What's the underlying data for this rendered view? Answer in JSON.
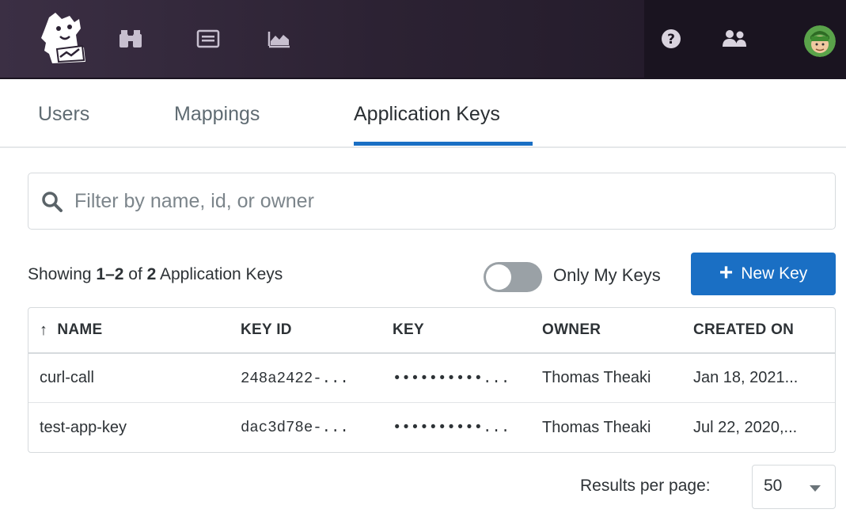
{
  "nav": {
    "icons": [
      "dog-logo-icon",
      "binoculars-icon",
      "monitor-icon",
      "metrics-chart-icon",
      "help-icon",
      "team-icon",
      "avatar"
    ]
  },
  "tabs": [
    {
      "label": "Users",
      "active": false
    },
    {
      "label": "Mappings",
      "active": false
    },
    {
      "label": "Application Keys",
      "active": true
    }
  ],
  "search": {
    "placeholder": "Filter by name, id, or owner",
    "value": ""
  },
  "summary": {
    "prefix": "Showing ",
    "range": "1–2",
    "of": " of ",
    "total": "2",
    "suffix": " Application Keys"
  },
  "toggle": {
    "label": "Only My Keys",
    "on": false
  },
  "new_key_button": {
    "label": "New Key"
  },
  "table": {
    "sort_arrow": "↑",
    "columns": [
      "NAME",
      "KEY ID",
      "KEY",
      "OWNER",
      "CREATED ON"
    ],
    "rows": [
      {
        "name": "curl-call",
        "key_id": "248a2422-...",
        "key": "••••••••••...",
        "owner": "Thomas Theaki",
        "created": "Jan 18, 2021..."
      },
      {
        "name": "test-app-key",
        "key_id": "dac3d78e-...",
        "key": "••••••••••...",
        "owner": "Thomas Theaki",
        "created": "Jul 22, 2020,..."
      }
    ]
  },
  "pagination": {
    "label": "Results per page:",
    "value": "50"
  },
  "colors": {
    "accent": "#1a6fc4",
    "topbar": "#2c2233",
    "toggle_off": "#9aa1a6"
  }
}
